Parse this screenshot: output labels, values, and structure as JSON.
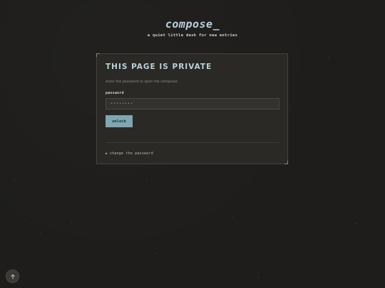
{
  "brand": {
    "logo": "compose_",
    "tagline": "a quiet little desk for new entries"
  },
  "card": {
    "title": "THIS PAGE IS PRIVATE",
    "subtitle": "enter the password to open the composer.",
    "password_label": "password",
    "password_placeholder": "••••••••",
    "unlock_label": "unlock",
    "change_password_caret": "▶",
    "change_password_label": "change the password"
  },
  "scroll_top": {
    "icon": "arrow-up-icon"
  },
  "colors": {
    "background": "#1e1d1b",
    "card": "#2a2926",
    "accent": "#7fa6b3",
    "title": "#b8d2da"
  }
}
